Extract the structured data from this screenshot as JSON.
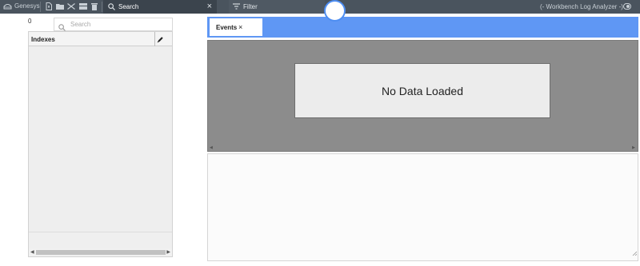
{
  "toolbar": {
    "brand": "Genesys",
    "tools": [
      {
        "icon": "open-file-icon"
      },
      {
        "icon": "folder-icon"
      },
      {
        "icon": "merge-icon"
      },
      {
        "icon": "layout-icon"
      },
      {
        "icon": "trash-icon"
      }
    ],
    "search_label": "Search",
    "search_close": "×",
    "filter_label": "Filter",
    "app_title": "(- Workbench Log Analyzer -)"
  },
  "left_panel": {
    "count": "0",
    "search_placeholder": "Search",
    "column_header": "Indexes"
  },
  "main": {
    "tabs": [
      {
        "label": "Events",
        "close": "×"
      }
    ],
    "empty_message": "No Data Loaded"
  },
  "colors": {
    "toolbar_bg": "#4a545e",
    "tabstrip_bg": "#5f97f4",
    "grid_bg": "#8c8c8c"
  }
}
